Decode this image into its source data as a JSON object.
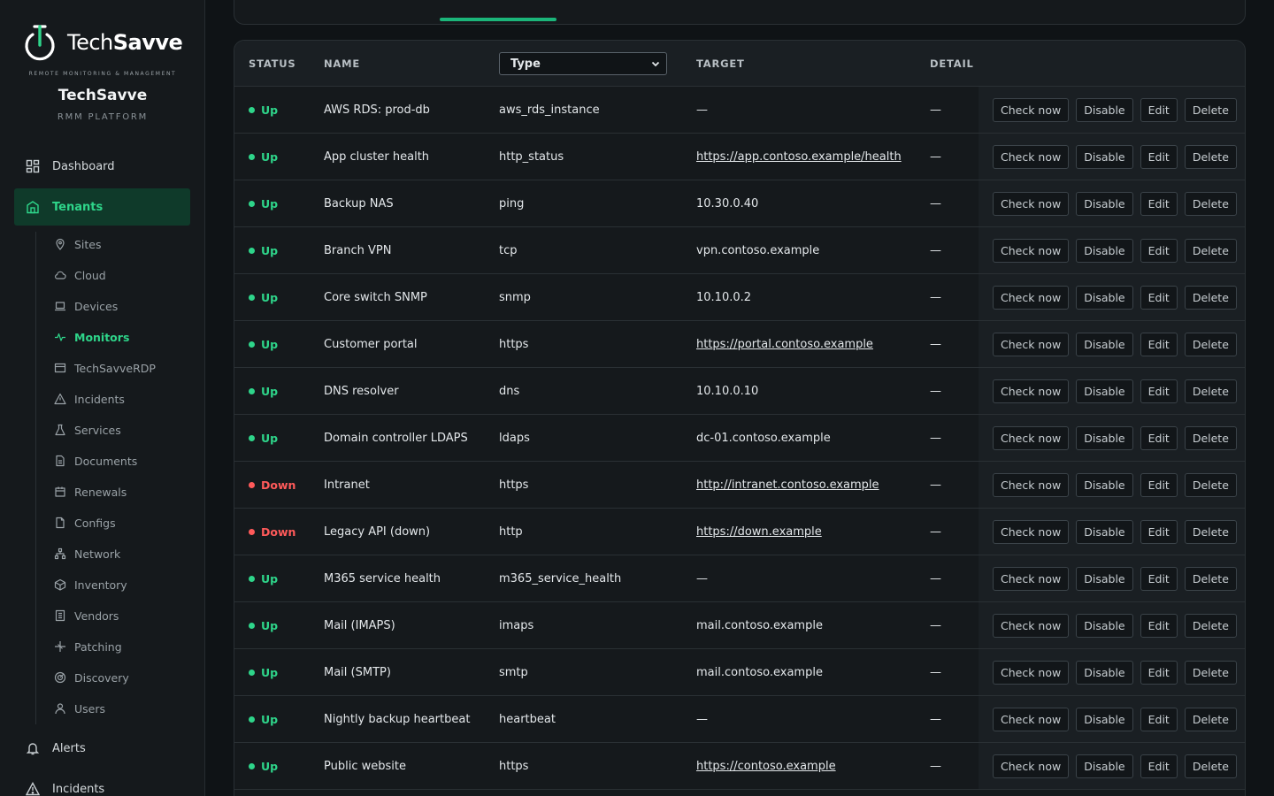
{
  "brand": {
    "logo_light": "Tech",
    "logo_bold": "Savve",
    "tagline": "REMOTE MONITORING & MANAGEMENT",
    "title": "TechSavve",
    "subtitle": "RMM PLATFORM"
  },
  "colors": {
    "accent": "#2ed58a",
    "down": "#ff5a5a",
    "background": "#0f1316",
    "sidebar": "#15191c"
  },
  "nav": {
    "dashboard": {
      "label": "Dashboard",
      "icon": "dashboard-icon"
    },
    "tenants": {
      "label": "Tenants",
      "icon": "building-icon"
    },
    "alerts": {
      "label": "Alerts",
      "icon": "bell-icon"
    },
    "incidents": {
      "label": "Incidents",
      "icon": "warning-icon"
    },
    "sub": [
      {
        "label": "Sites",
        "icon": "pin-icon"
      },
      {
        "label": "Cloud",
        "icon": "cloud-icon"
      },
      {
        "label": "Devices",
        "icon": "laptop-icon"
      },
      {
        "label": "Monitors",
        "icon": "pulse-icon"
      },
      {
        "label": "TechSavveRDP",
        "icon": "window-icon"
      },
      {
        "label": "Incidents",
        "icon": "warning-icon"
      },
      {
        "label": "Services",
        "icon": "flask-icon"
      },
      {
        "label": "Documents",
        "icon": "document-icon"
      },
      {
        "label": "Renewals",
        "icon": "calendar-icon"
      },
      {
        "label": "Configs",
        "icon": "file-icon"
      },
      {
        "label": "Network",
        "icon": "network-icon"
      },
      {
        "label": "Inventory",
        "icon": "box-icon"
      },
      {
        "label": "Vendors",
        "icon": "vendor-icon"
      },
      {
        "label": "Patching",
        "icon": "sparkle-icon"
      },
      {
        "label": "Discovery",
        "icon": "radar-icon"
      },
      {
        "label": "Users",
        "icon": "user-icon"
      }
    ]
  },
  "table": {
    "headers": {
      "status": "STATUS",
      "name": "NAME",
      "type_filter": "Type",
      "target": "TARGET",
      "detail": "DETAIL"
    },
    "actions": {
      "check": "Check now",
      "disable": "Disable",
      "edit": "Edit",
      "delete": "Delete"
    },
    "rows": [
      {
        "status": "Up",
        "name": "AWS RDS: prod-db",
        "type": "aws_rds_instance",
        "target": "—",
        "detail": "—"
      },
      {
        "status": "Up",
        "name": "App cluster health",
        "type": "http_status",
        "target": "https://app.contoso.example/health",
        "detail": "—"
      },
      {
        "status": "Up",
        "name": "Backup NAS",
        "type": "ping",
        "target": "10.30.0.40",
        "detail": "—"
      },
      {
        "status": "Up",
        "name": "Branch VPN",
        "type": "tcp",
        "target": "vpn.contoso.example",
        "detail": "—"
      },
      {
        "status": "Up",
        "name": "Core switch SNMP",
        "type": "snmp",
        "target": "10.10.0.2",
        "detail": "—"
      },
      {
        "status": "Up",
        "name": "Customer portal",
        "type": "https",
        "target": "https://portal.contoso.example",
        "detail": "—"
      },
      {
        "status": "Up",
        "name": "DNS resolver",
        "type": "dns",
        "target": "10.10.0.10",
        "detail": "—"
      },
      {
        "status": "Up",
        "name": "Domain controller LDAPS",
        "type": "ldaps",
        "target": "dc-01.contoso.example",
        "detail": "—"
      },
      {
        "status": "Down",
        "name": "Intranet",
        "type": "https",
        "target": "http://intranet.contoso.example",
        "detail": "—"
      },
      {
        "status": "Down",
        "name": "Legacy API (down)",
        "type": "http",
        "target": "https://down.example",
        "detail": "—"
      },
      {
        "status": "Up",
        "name": "M365 service health",
        "type": "m365_service_health",
        "target": "—",
        "detail": "—"
      },
      {
        "status": "Up",
        "name": "Mail (IMAPS)",
        "type": "imaps",
        "target": "mail.contoso.example",
        "detail": "—"
      },
      {
        "status": "Up",
        "name": "Mail (SMTP)",
        "type": "smtp",
        "target": "mail.contoso.example",
        "detail": "—"
      },
      {
        "status": "Up",
        "name": "Nightly backup heartbeat",
        "type": "heartbeat",
        "target": "—",
        "detail": "—"
      },
      {
        "status": "Up",
        "name": "Public website",
        "type": "https",
        "target": "https://contoso.example",
        "detail": "—"
      }
    ]
  }
}
